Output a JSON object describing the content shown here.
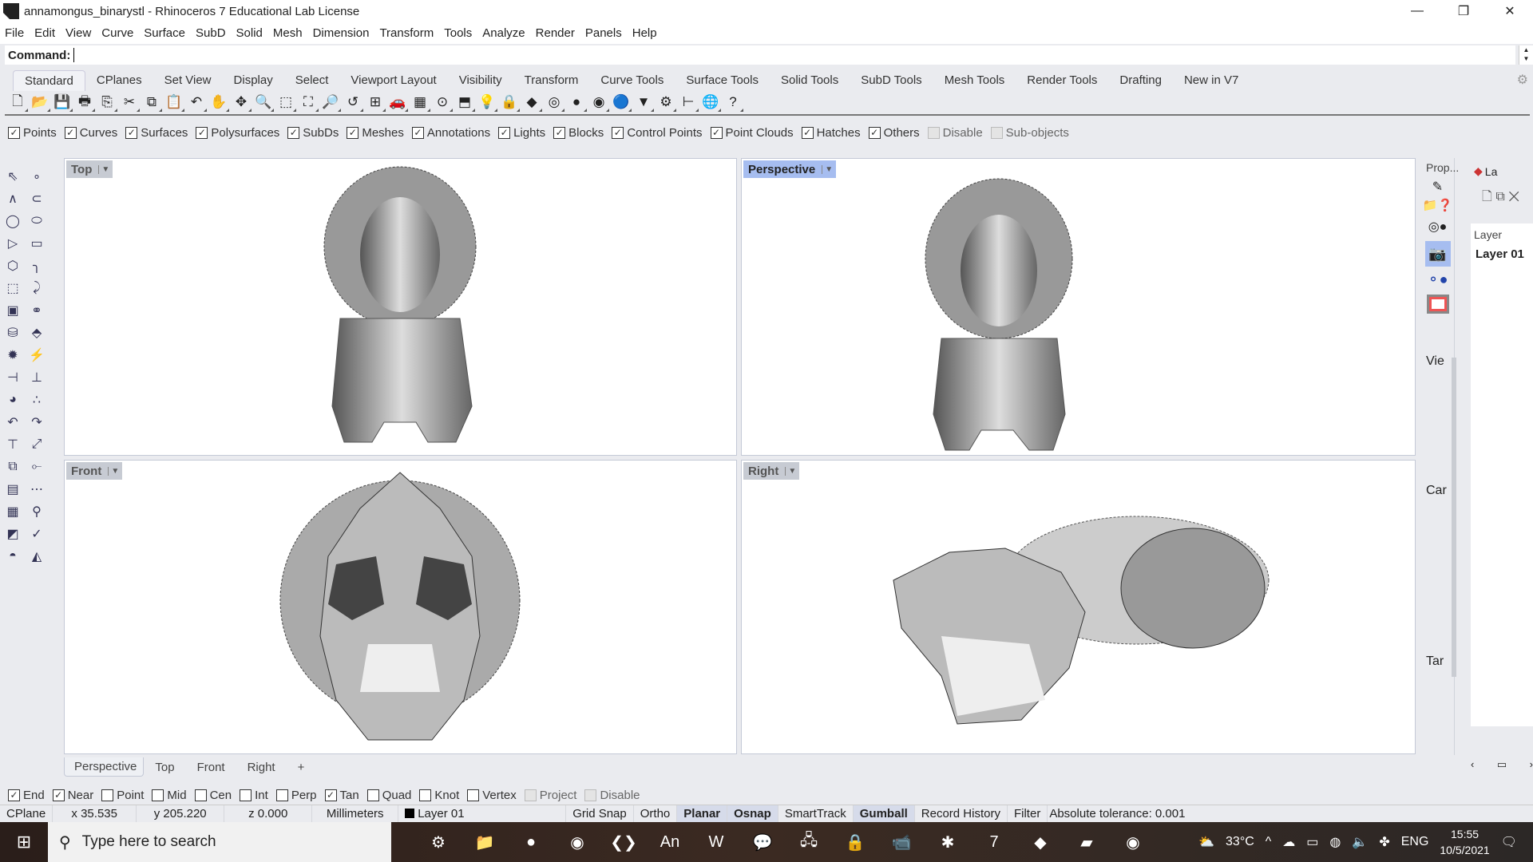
{
  "window": {
    "title": "annamongus_binarystl - Rhinoceros 7 Educational Lab License",
    "min": "—",
    "max": "❐",
    "close": "✕"
  },
  "menu": [
    "File",
    "Edit",
    "View",
    "Curve",
    "Surface",
    "SubD",
    "Solid",
    "Mesh",
    "Dimension",
    "Transform",
    "Tools",
    "Analyze",
    "Render",
    "Panels",
    "Help"
  ],
  "command": {
    "label": "Command:",
    "value": ""
  },
  "tabs": [
    "Standard",
    "CPlanes",
    "Set View",
    "Display",
    "Select",
    "Viewport Layout",
    "Visibility",
    "Transform",
    "Curve Tools",
    "Surface Tools",
    "Solid Tools",
    "SubD Tools",
    "Mesh Tools",
    "Render Tools",
    "Drafting",
    "New in V7"
  ],
  "toolbar_icons": [
    {
      "n": "new-icon",
      "g": "🗋"
    },
    {
      "n": "open-icon",
      "g": "📂"
    },
    {
      "n": "save-icon",
      "g": "💾"
    },
    {
      "n": "print-icon",
      "g": "🖶"
    },
    {
      "n": "export-icon",
      "g": "⎘"
    },
    {
      "n": "cut-icon",
      "g": "✂"
    },
    {
      "n": "copy-icon",
      "g": "⧉"
    },
    {
      "n": "paste-icon",
      "g": "📋"
    },
    {
      "n": "undo-icon",
      "g": "↶"
    },
    {
      "n": "pan-icon",
      "g": "✋"
    },
    {
      "n": "rotate-view-icon",
      "g": "✥"
    },
    {
      "n": "zoom-icon",
      "g": "🔍"
    },
    {
      "n": "zoom-window-icon",
      "g": "⬚"
    },
    {
      "n": "zoom-extents-icon",
      "g": "⛶"
    },
    {
      "n": "zoom-selected-icon",
      "g": "🔎"
    },
    {
      "n": "undo-view-icon",
      "g": "↺"
    },
    {
      "n": "four-viewports-icon",
      "g": "⊞"
    },
    {
      "n": "car-icon",
      "g": "🚗"
    },
    {
      "n": "cplane-icon",
      "g": "▦"
    },
    {
      "n": "snap-icon",
      "g": "⊙"
    },
    {
      "n": "properties-icon",
      "g": "⬒"
    },
    {
      "n": "light-icon",
      "g": "💡"
    },
    {
      "n": "lock-icon",
      "g": "🔒"
    },
    {
      "n": "layers-icon",
      "g": "◆"
    },
    {
      "n": "color-wheel-icon",
      "g": "◎"
    },
    {
      "n": "shaded-sphere-icon",
      "g": "●"
    },
    {
      "n": "rendered-sphere-icon",
      "g": "◉"
    },
    {
      "n": "render-sphere-icon",
      "g": "🔵"
    },
    {
      "n": "material-icon",
      "g": "▼"
    },
    {
      "n": "options-icon",
      "g": "⚙"
    },
    {
      "n": "dimension-icon",
      "g": "⊢"
    },
    {
      "n": "globe-icon",
      "g": "🌐"
    },
    {
      "n": "help-icon",
      "g": "?"
    }
  ],
  "filters": [
    {
      "label": "Points",
      "checked": true
    },
    {
      "label": "Curves",
      "checked": true
    },
    {
      "label": "Surfaces",
      "checked": true
    },
    {
      "label": "Polysurfaces",
      "checked": true
    },
    {
      "label": "SubDs",
      "checked": true
    },
    {
      "label": "Meshes",
      "checked": true
    },
    {
      "label": "Annotations",
      "checked": true
    },
    {
      "label": "Lights",
      "checked": true
    },
    {
      "label": "Blocks",
      "checked": true
    },
    {
      "label": "Control Points",
      "checked": true
    },
    {
      "label": "Point Clouds",
      "checked": true
    },
    {
      "label": "Hatches",
      "checked": true
    },
    {
      "label": "Others",
      "checked": true
    },
    {
      "label": "Disable",
      "checked": false,
      "disabled": true
    },
    {
      "label": "Sub-objects",
      "checked": false,
      "disabled": true
    }
  ],
  "viewports": {
    "top": "Top",
    "perspective": "Perspective",
    "front": "Front",
    "right": "Right"
  },
  "viewport_tabs": [
    "Perspective",
    "Top",
    "Front",
    "Right"
  ],
  "add_tab": "+",
  "osnaps": [
    {
      "label": "End",
      "checked": true
    },
    {
      "label": "Near",
      "checked": true
    },
    {
      "label": "Point",
      "checked": false
    },
    {
      "label": "Mid",
      "checked": false
    },
    {
      "label": "Cen",
      "checked": false
    },
    {
      "label": "Int",
      "checked": false
    },
    {
      "label": "Perp",
      "checked": false
    },
    {
      "label": "Tan",
      "checked": true
    },
    {
      "label": "Quad",
      "checked": false
    },
    {
      "label": "Knot",
      "checked": false
    },
    {
      "label": "Vertex",
      "checked": false
    },
    {
      "label": "Project",
      "checked": false,
      "disabled": true
    },
    {
      "label": "Disable",
      "checked": false,
      "disabled": true
    }
  ],
  "status": {
    "cplane": "CPlane",
    "x": "x 35.535",
    "y": "y 205.220",
    "z": "z 0.000",
    "units": "Millimeters",
    "layer": "Layer 01",
    "grid_snap": "Grid Snap",
    "ortho": "Ortho",
    "planar": "Planar",
    "osnap": "Osnap",
    "smarttrack": "SmartTrack",
    "gumball": "Gumball",
    "record_history": "Record History",
    "filter": "Filter",
    "tolerance": "Absolute tolerance: 0.001"
  },
  "panels": {
    "properties_tab": "Prop...",
    "layers_tab": "La",
    "layer_header": "Layer",
    "layer_name": "Layer 01",
    "side_labels": [
      "Vie",
      "Car",
      "Tar"
    ]
  },
  "taskbar": {
    "search_placeholder": "Type here to search",
    "weather": "33°C",
    "lang": "ENG",
    "time": "15:55",
    "date": "10/5/2021",
    "apps": [
      {
        "n": "settings-app",
        "g": "⚙"
      },
      {
        "n": "file-explorer-app",
        "g": "📁"
      },
      {
        "n": "spotify-app",
        "g": "●"
      },
      {
        "n": "chrome-app",
        "g": "◉"
      },
      {
        "n": "vscode-app",
        "g": "❮❯"
      },
      {
        "n": "animate-app",
        "g": "An"
      },
      {
        "n": "word-app",
        "g": "W"
      },
      {
        "n": "wechat-app",
        "g": "💬"
      },
      {
        "n": "network-app",
        "g": "🖧"
      },
      {
        "n": "vpn-app",
        "g": "🔒"
      },
      {
        "n": "zoom-app",
        "g": "📹"
      },
      {
        "n": "slack-app",
        "g": "✱"
      },
      {
        "n": "rhino-app",
        "g": "7"
      },
      {
        "n": "sketch-app",
        "g": "◆"
      },
      {
        "n": "sticky-notes-app",
        "g": "▰"
      },
      {
        "n": "chrome-profile-app",
        "g": "◉"
      }
    ]
  }
}
